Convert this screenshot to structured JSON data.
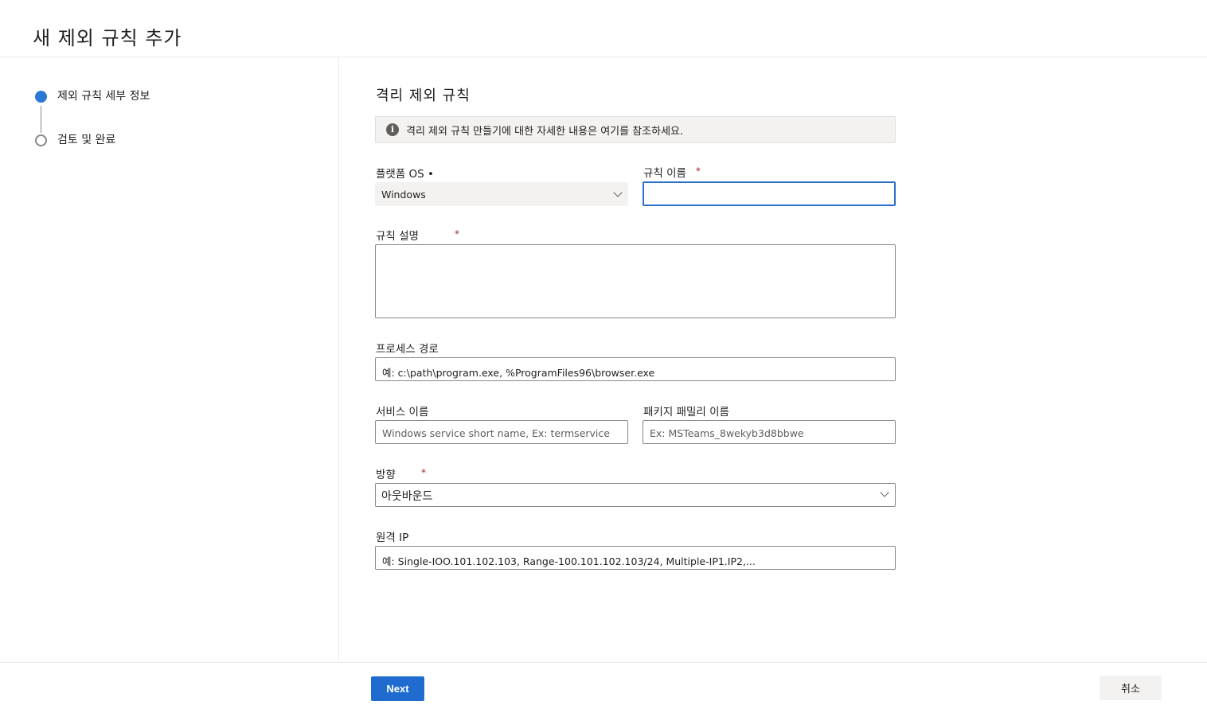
{
  "header": {
    "title": "새 제외 규칙 추가"
  },
  "steps": [
    {
      "label": "제외 규칙 세부 정보",
      "state": "active"
    },
    {
      "label": "검토 및 완료",
      "state": "inactive"
    }
  ],
  "section": {
    "title": "격리 제외 규칙"
  },
  "info": {
    "text": "격리 제외 규칙 만들기에 대한 자세한 내용은 여기를 참조하세요.",
    "icon": "info-icon"
  },
  "form": {
    "platform": {
      "label": "플랫폼 OS •",
      "value": "Windows"
    },
    "rule_name": {
      "label": "규칙 이름",
      "required": "*",
      "value": ""
    },
    "rule_desc": {
      "label": "규칙 설명",
      "required": "*",
      "value": ""
    },
    "process_path": {
      "label": "프로세스 경로",
      "placeholder": "예: c:\\path\\program.exe, %ProgramFiles96\\browser.exe"
    },
    "service_name": {
      "label": "서비스 이름",
      "placeholder": "Windows service short name, Ex: termservice"
    },
    "package_family": {
      "label": "패키지 패밀리 이름",
      "placeholder": "Ex: MSTeams_8wekyb3d8bbwe"
    },
    "direction": {
      "label": "방향",
      "required": "*",
      "value": "아웃바운드"
    },
    "remote_ip": {
      "label": "원격 IP",
      "placeholder": "예: Single-IOO.101.102.103, Range-100.101.102.103/24, Multiple-IP1.IP2,..."
    }
  },
  "footer": {
    "next_label": "Next",
    "cancel_label": "취소"
  },
  "colors": {
    "accent": "#1f6bd0",
    "required": "#a4262c"
  }
}
